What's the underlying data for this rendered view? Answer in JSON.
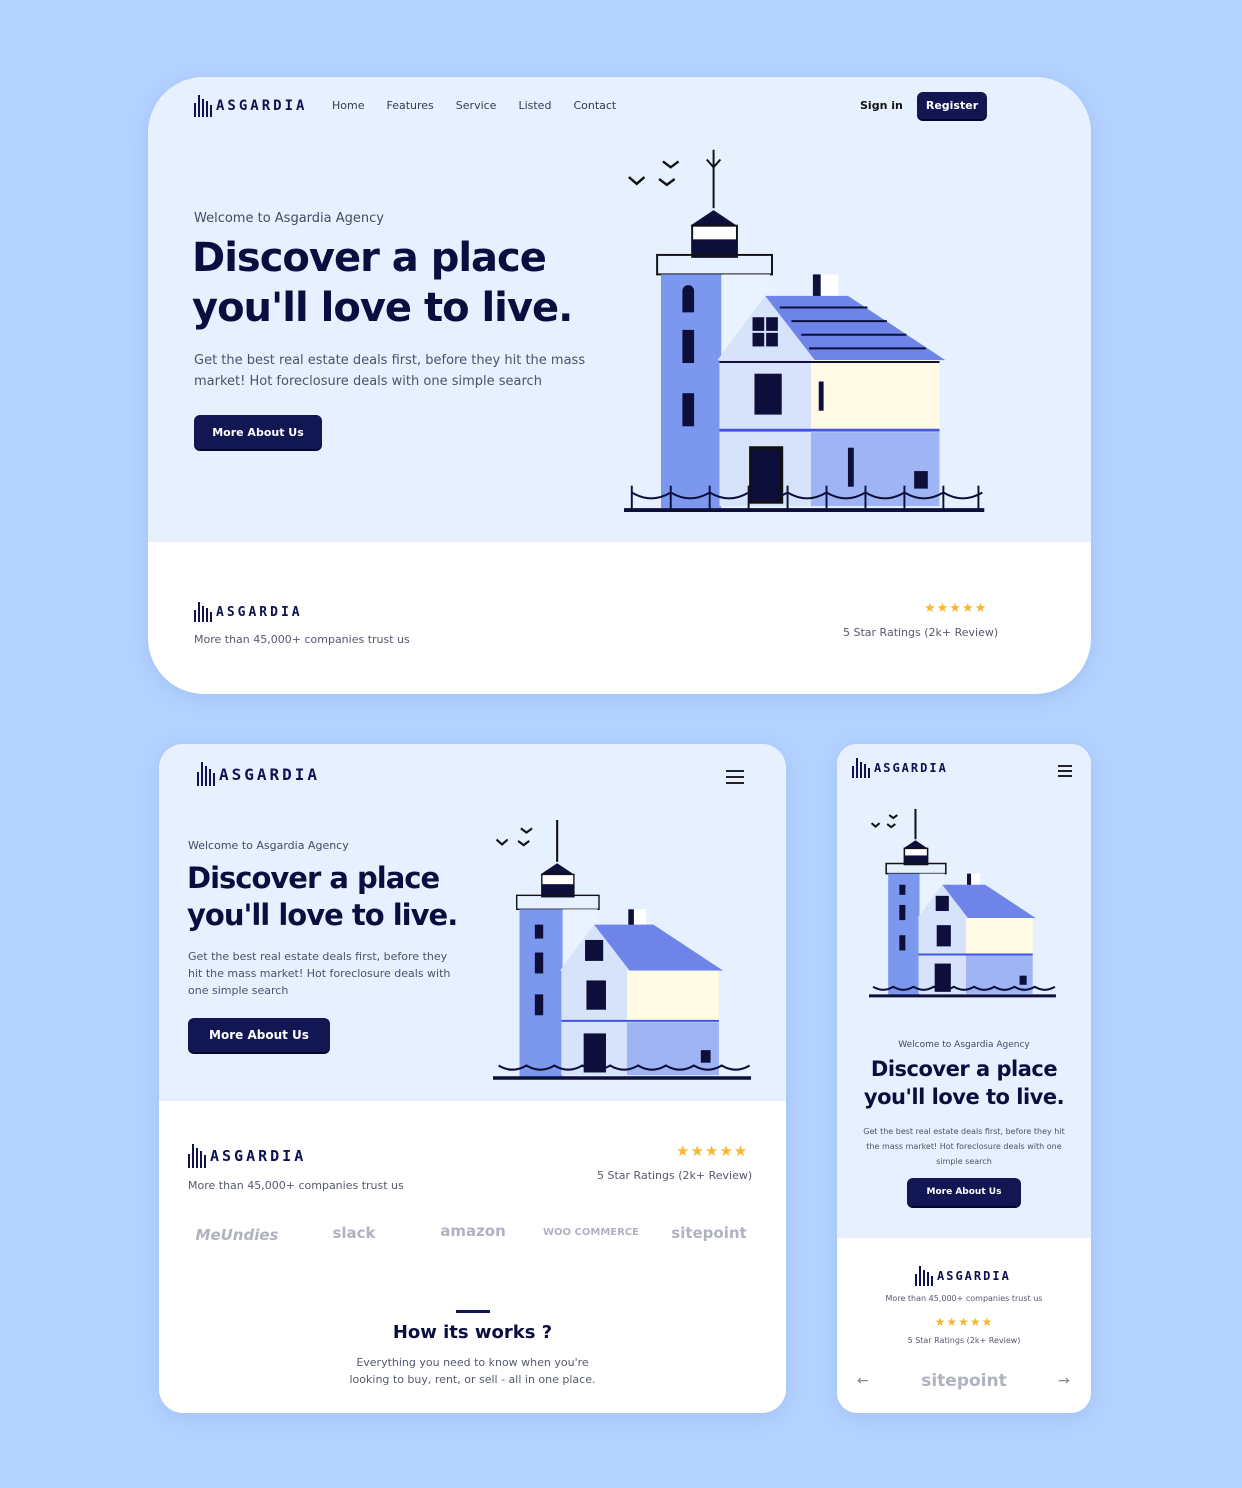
{
  "brand": "ASGARDIA",
  "nav": [
    "Home",
    "Features",
    "Service",
    "Listed",
    "Contact"
  ],
  "signin": "Sign in",
  "register": "Register",
  "hero": {
    "eyebrow": "Welcome to Asgardia Agency",
    "title_l1": "Discover a place",
    "title_l2": "you'll love to live.",
    "desc_desktop_l1": "Get the best real estate deals first, before they hit the mass",
    "desc_desktop_l2": "market! Hot foreclosure deals with one simple search",
    "desc_tablet_l1": "Get the best real estate deals first, before they",
    "desc_tablet_l2": "hit the mass market! Hot foreclosure deals with",
    "desc_tablet_l3": "one simple search",
    "desc_mobile_l1": "Get the best real estate deals first, before they hit",
    "desc_mobile_l2": "the mass market! Hot foreclosure deals with one",
    "desc_mobile_l3": "simple search",
    "cta": "More About Us"
  },
  "trust": "More than 45,000+ companies trust us",
  "stars": "★★★★★",
  "rating": "5 Star Ratings (2k+ Review)",
  "partners": [
    "MeUndies",
    "slack",
    "amazon",
    "WOO COMMERCE",
    "sitepoint"
  ],
  "how": {
    "title": "How its works ?",
    "desc_l1": "Everything you need to know when you're",
    "desc_l2": "looking to buy, rent, or sell - all in one place."
  },
  "mobile_partner": "sitepoint",
  "arrows": {
    "prev": "←",
    "next": "→"
  },
  "colors": {
    "accent": "#121652",
    "hero_bg": "#e6f0ff",
    "page_bg": "#b4d2ff",
    "star": "#f7b731"
  }
}
